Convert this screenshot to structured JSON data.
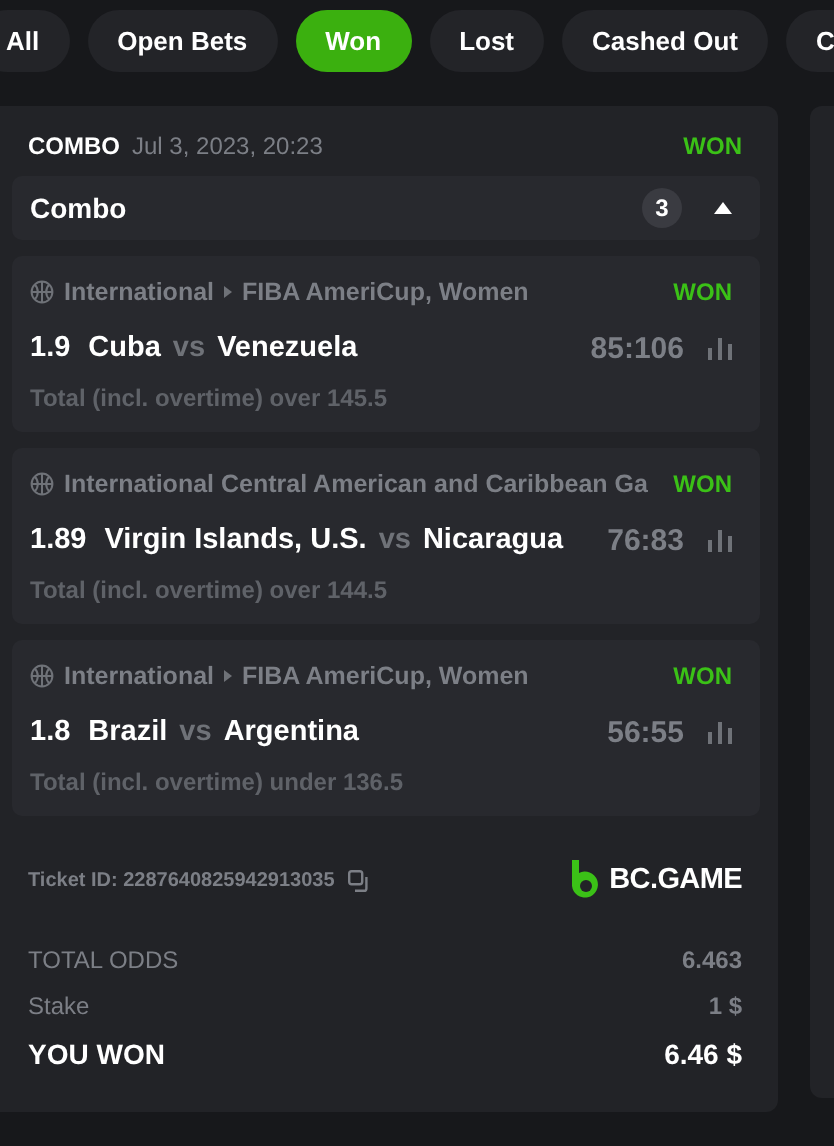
{
  "tabs": [
    {
      "label": "All",
      "selected": false
    },
    {
      "label": "Open Bets",
      "selected": false
    },
    {
      "label": "Won",
      "selected": true
    },
    {
      "label": "Lost",
      "selected": false
    },
    {
      "label": "Cashed Out",
      "selected": false
    },
    {
      "label": "C",
      "selected": false
    }
  ],
  "bet": {
    "type": "COMBO",
    "date": "Jul 3, 2023, 20:23",
    "status": {
      "text": "WON",
      "kind": "won"
    },
    "group": {
      "title": "Combo",
      "count": "3",
      "expanded": true
    },
    "legs": [
      {
        "country": "International",
        "competition": "FIBA AmeriCup, Women",
        "status": {
          "text": "WON",
          "kind": "won"
        },
        "odds": "1.9",
        "home": "Cuba",
        "vs": "vs",
        "away": "Venezuela",
        "score": "85:106",
        "market": "Total (incl. overtime) over 145.5"
      },
      {
        "country": "International Central American and Caribbean Ga",
        "status": {
          "text": "WON",
          "kind": "won"
        },
        "odds": "1.89",
        "home": "Virgin Islands, U.S.",
        "vs": "vs",
        "away": "Nicaragua",
        "score": "76:83",
        "market": "Total (incl. overtime) over 144.5"
      },
      {
        "country": "International",
        "competition": "FIBA AmeriCup, Women",
        "status": {
          "text": "WON",
          "kind": "won"
        },
        "odds": "1.8",
        "home": "Brazil",
        "vs": "vs",
        "away": "Argentina",
        "score": "56:55",
        "market": "Total (incl. overtime) under 136.5"
      }
    ],
    "ticket_id": "Ticket ID: 2287640825942913035",
    "brand": "BC.GAME",
    "summary": [
      {
        "label": "TOTAL ODDS",
        "value": "6.463",
        "kind": "plain"
      },
      {
        "label": "Stake",
        "value": "1 $",
        "kind": "plain"
      },
      {
        "label": "YOU WON",
        "value": "6.46 $",
        "kind": "result"
      }
    ]
  }
}
